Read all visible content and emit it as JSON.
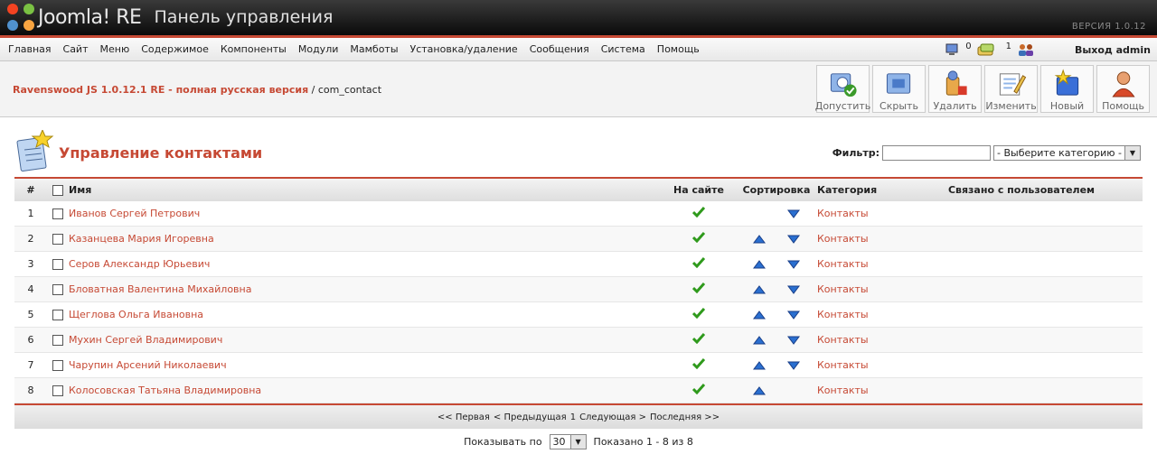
{
  "header": {
    "logo": "Joomla! RE",
    "subtitle": "Панель управления",
    "version": "ВЕРСИЯ 1.0.12"
  },
  "menu": {
    "items": [
      "Главная",
      "Сайт",
      "Меню",
      "Содержимое",
      "Компоненты",
      "Модули",
      "Мамботы",
      "Установка/удаление",
      "Сообщения",
      "Система",
      "Помощь"
    ],
    "messages_count": "0",
    "users_online": "1",
    "logout": "Выход admin"
  },
  "breadcrumb": {
    "site": "Ravenswood JS 1.0.12.1 RE - полная русская версия",
    "separator": " / ",
    "component": "com_contact"
  },
  "toolbar": {
    "publish": "Допустить",
    "unpublish": "Скрыть",
    "delete": "Удалить",
    "edit": "Изменить",
    "new": "Новый",
    "help": "Помощь"
  },
  "page": {
    "title": "Управление контактами",
    "filter_label": "Фильтр:",
    "filter_value": "",
    "category_select": "- Выберите категорию -"
  },
  "table": {
    "headers": {
      "num": "#",
      "name": "Имя",
      "published": "На сайте",
      "ordering": "Сортировка",
      "category": "Категория",
      "linked_user": "Связано с пользователем"
    },
    "rows": [
      {
        "num": "1",
        "name": "Иванов Сергей Петрович",
        "category": "Контакты",
        "up": false,
        "down": true
      },
      {
        "num": "2",
        "name": "Казанцева Мария Игоревна",
        "category": "Контакты",
        "up": true,
        "down": true
      },
      {
        "num": "3",
        "name": "Серов Александр Юрьевич",
        "category": "Контакты",
        "up": true,
        "down": true
      },
      {
        "num": "4",
        "name": "Бловатная Валентина Михайловна",
        "category": "Контакты",
        "up": true,
        "down": true
      },
      {
        "num": "5",
        "name": "Щеглова Ольга Ивановна",
        "category": "Контакты",
        "up": true,
        "down": true
      },
      {
        "num": "6",
        "name": "Мухин Сергей Владимирович",
        "category": "Контакты",
        "up": true,
        "down": true
      },
      {
        "num": "7",
        "name": "Чарупин Арсений Николаевич",
        "category": "Контакты",
        "up": true,
        "down": true
      },
      {
        "num": "8",
        "name": "Колосовская Татьяна Владимировна",
        "category": "Контакты",
        "up": true,
        "down": false
      }
    ]
  },
  "pagination": {
    "first": "<< Первая",
    "prev": "< Предыдущая",
    "current": "1",
    "next": "Следующая >",
    "last": "Последняя >>",
    "show_label": "Показывать по",
    "per_page": "30",
    "summary": "Показано 1 - 8 из 8"
  },
  "colors": {
    "accent": "#c64934",
    "check": "#2f9a1c",
    "arrow": "#2a6fd0"
  }
}
